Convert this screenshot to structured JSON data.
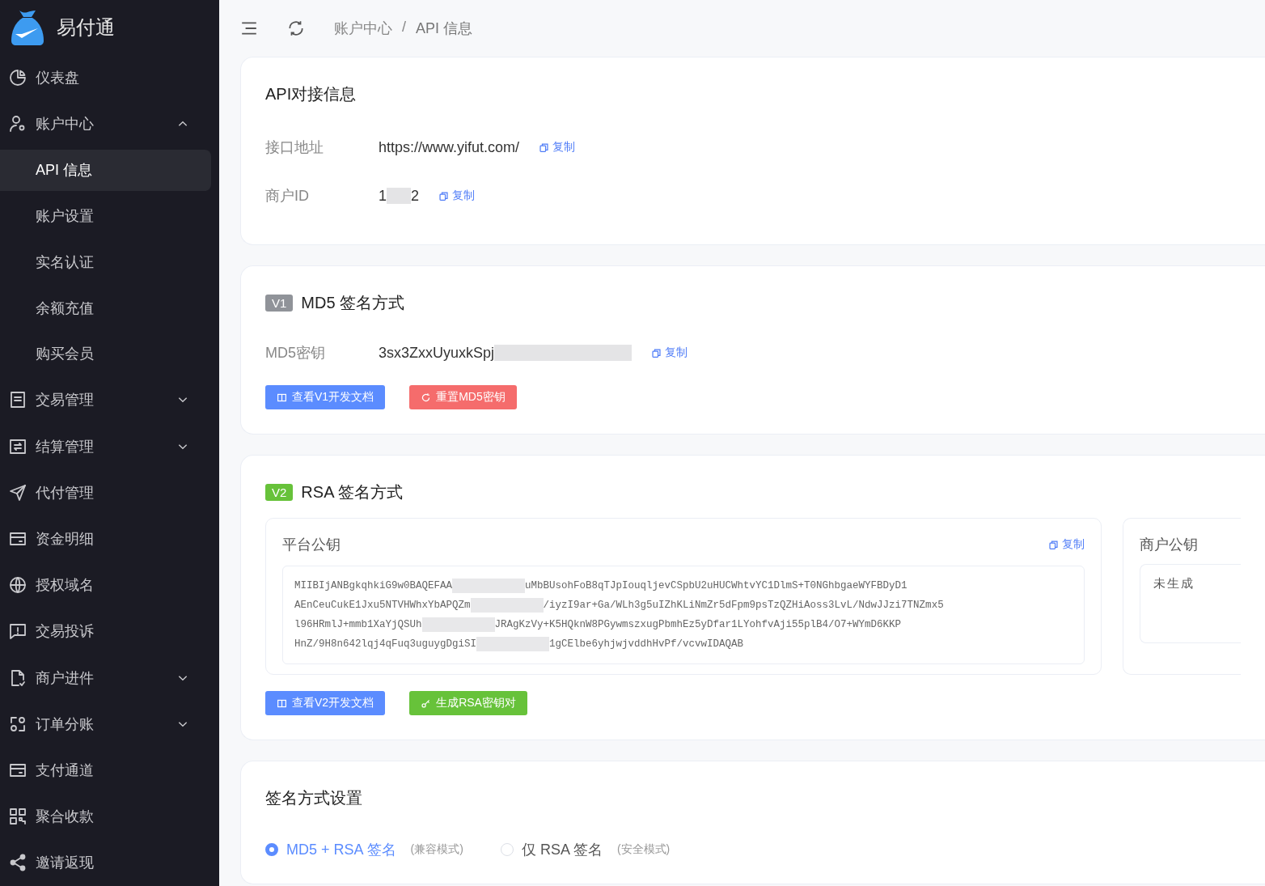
{
  "sidebar": {
    "brand": "易付通",
    "items": [
      {
        "label": "仪表盘",
        "selected": false
      },
      {
        "label": "账户中心",
        "expanded": true,
        "selected": false,
        "children": [
          {
            "label": "API 信息",
            "selected": true
          },
          {
            "label": "账户设置",
            "selected": false
          },
          {
            "label": "实名认证",
            "selected": false
          },
          {
            "label": "余额充值",
            "selected": false
          },
          {
            "label": "购买会员",
            "selected": false
          }
        ]
      },
      {
        "label": "交易管理",
        "expanded": false,
        "selected": false
      },
      {
        "label": "结算管理",
        "expanded": false,
        "selected": false
      },
      {
        "label": "代付管理",
        "selected": false
      },
      {
        "label": "资金明细",
        "selected": false
      },
      {
        "label": "授权域名",
        "selected": false
      },
      {
        "label": "交易投诉",
        "selected": false
      },
      {
        "label": "商户进件",
        "expanded": false,
        "selected": false
      },
      {
        "label": "订单分账",
        "expanded": false,
        "selected": false
      },
      {
        "label": "支付通道",
        "selected": false
      },
      {
        "label": "聚合收款",
        "selected": false
      },
      {
        "label": "邀请返现",
        "selected": false
      }
    ]
  },
  "breadcrumb": [
    "账户中心",
    "/",
    "API 信息"
  ],
  "api_card": {
    "title": "API对接信息",
    "fields": [
      {
        "label": "接口地址",
        "value": "https://www.yifut.com/",
        "copy": "复制"
      },
      {
        "label": "商户ID",
        "value": "1",
        "value_end": "2",
        "redacted": true,
        "copy": "复制"
      }
    ]
  },
  "md5_card": {
    "badge": "V1",
    "title": "MD5 签名方式",
    "fields": [
      {
        "label": "MD5密钥",
        "value": "3sx3ZxxUyuxkSpj",
        "redacted": true,
        "copy": "复制"
      }
    ],
    "buttons": [
      {
        "label": "查看V1开发文档",
        "kind": "docs"
      },
      {
        "label": "重置MD5密钥",
        "kind": "reset"
      }
    ]
  },
  "rsa_card": {
    "badge": "V2",
    "title": "RSA 签名方式",
    "platform_key": {
      "title": "平台公钥",
      "copy": "复制",
      "lines": [
        {
          "start": "MIIBIjANBgkqhkiG9w0BAQEFAA",
          "end": "uMbBUsohFoB8qTJpIouqljevCSpbU2uHUCWhtvYC1DlmS+T0NGhbgaeWYFBDyD1"
        },
        {
          "start": "AEnCeuCukE1Jxu5NTVHWhxYbAPQZm",
          "end": "/iyzI9ar+Ga/WLh3g5uIZhKLiNmZr5dFpm9psTzQZHiAoss3LvL/NdwJJzi7TNZmx5"
        },
        {
          "start": "l96HRmlJ+mmb1XaYjQSUh",
          "end": "JRAgKzVy+K5HQknW8PGywmszxugPbmhEz5yDfar1LYohfvAji55plB4/O7+WYmD6KKP"
        },
        {
          "start": "HnZ/9H8n642lqj4qFuq3uguygDgiSI",
          "end": "1gCElbe6yhjwjvddhHvPf/vcvwIDAQAB"
        }
      ]
    },
    "merchant_key": {
      "title": "商户公钥",
      "value": "未生成"
    },
    "buttons": [
      {
        "label": "查看V2开发文档",
        "kind": "docs"
      },
      {
        "label": "生成RSA密钥对",
        "kind": "generate"
      }
    ]
  },
  "sign_card": {
    "title": "签名方式设置",
    "options": [
      {
        "label": "MD5 + RSA 签名",
        "note": "(兼容模式)",
        "selected": true
      },
      {
        "label": "仅 RSA 签名",
        "note": "(安全模式)",
        "selected": false
      }
    ]
  }
}
